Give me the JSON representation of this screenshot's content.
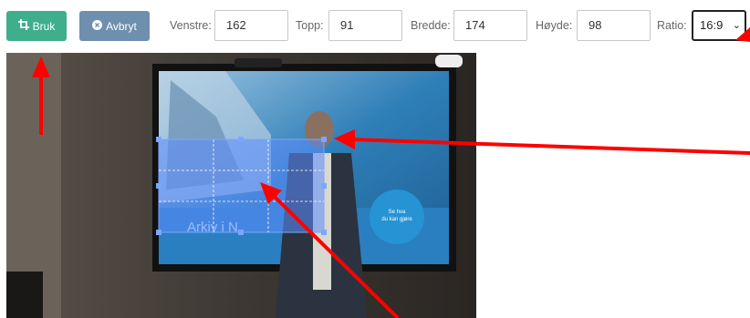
{
  "toolbar": {
    "apply_label": "Bruk",
    "cancel_label": "Avbryt",
    "left_label": "Venstre:",
    "left_value": "162",
    "top_label": "Topp:",
    "top_value": "91",
    "width_label": "Bredde:",
    "width_value": "174",
    "height_label": "Høyde:",
    "height_value": "98",
    "ratio_label": "Ratio:",
    "ratio_value": "16:9"
  },
  "photo": {
    "screen_text": "Arkiv i N",
    "circle_text_1": "Se hva",
    "circle_text_2": "du kan gjøre"
  },
  "colors": {
    "apply": "#3fae8c",
    "cancel": "#6f8faf",
    "arrow": "#ff0000",
    "crop": "#7aa7ff"
  },
  "icons": {
    "apply": "crop-icon",
    "cancel": "x-circle-icon",
    "ratio": "chevron-down-icon"
  }
}
